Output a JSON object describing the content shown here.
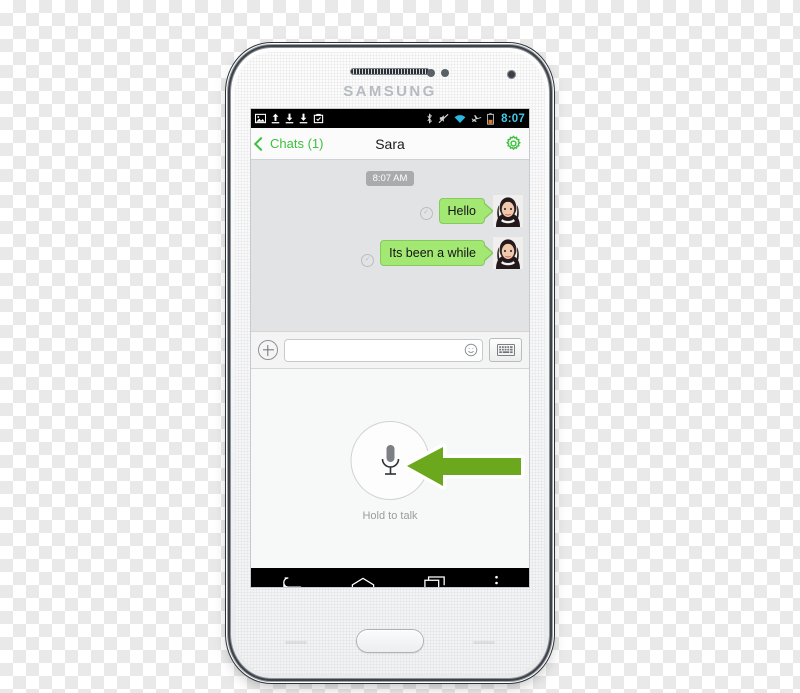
{
  "device": {
    "brand": "SAMSUNG",
    "earpiece_icon": "earpiece-grille",
    "front_camera_icon": "front-camera",
    "home_button_icon": "home-button"
  },
  "statusbar": {
    "left_icons": [
      "image-icon",
      "upload-icon",
      "download-icon",
      "download-icon",
      "screenshot-icon"
    ],
    "right_icons": [
      "bluetooth-icon",
      "mute-icon",
      "wifi-icon",
      "airplane-mode-icon",
      "battery-icon"
    ],
    "time": "8:07",
    "time_color": "#41c8e8",
    "background": "#000000"
  },
  "header": {
    "back_label": "Chats (1)",
    "back_icon": "chevron-left-icon",
    "title": "Sara",
    "settings_icon": "gear-icon",
    "accent_color": "#3cc13c"
  },
  "chat": {
    "timestamp": "8:07 AM",
    "background": "#e2e3e4",
    "bubble_color": "#a2e873",
    "messages": [
      {
        "text": "Hello",
        "side": "outgoing",
        "status_icon": "sent-check-icon",
        "avatar_icon": "avatar-sara"
      },
      {
        "text": "Its been a while",
        "side": "outgoing",
        "status_icon": "sent-check-icon",
        "avatar_icon": "avatar-sara"
      }
    ]
  },
  "inputbar": {
    "attach_icon": "plus-icon",
    "message_value": "",
    "message_placeholder": "",
    "emoji_icon": "smiley-icon",
    "keyboard_icon": "keyboard-icon"
  },
  "talk": {
    "mic_icon": "microphone-icon",
    "label": "Hold to talk",
    "pointer_icon": "green-arrow-left-icon",
    "pointer_color": "#6ca81e"
  },
  "navbar": {
    "back_icon": "nav-back-icon",
    "home_icon": "nav-home-icon",
    "recents_icon": "nav-recents-icon",
    "menu_icon": "nav-overflow-icon"
  }
}
